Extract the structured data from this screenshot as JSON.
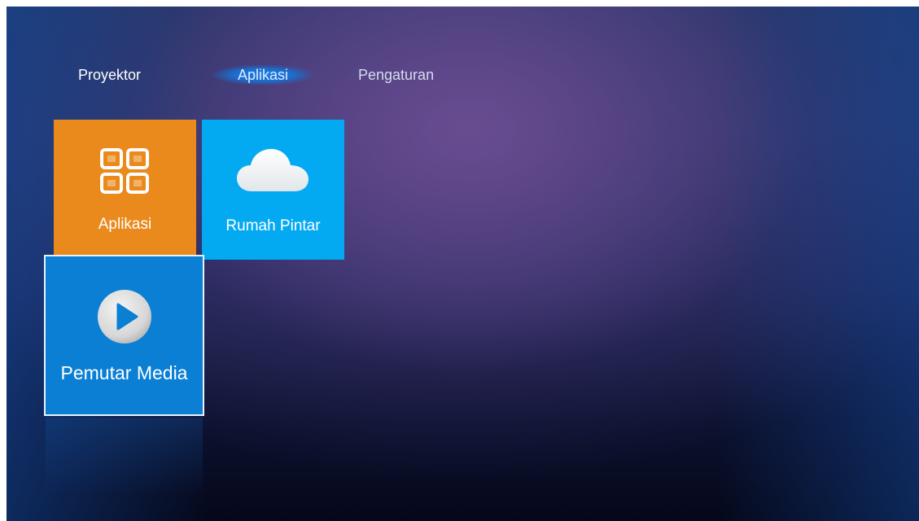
{
  "nav": {
    "tabs": [
      {
        "label": "Proyektor",
        "selected": false
      },
      {
        "label": "Aplikasi",
        "selected": true
      },
      {
        "label": "Pengaturan",
        "selected": false
      }
    ]
  },
  "tiles": [
    {
      "label": "Aplikasi",
      "icon": "apps-grid-icon",
      "color": "#ea8a1c"
    },
    {
      "label": "Rumah Pintar",
      "icon": "cloud-icon",
      "color": "#03aaf2"
    },
    {
      "label": "Pemutar Media",
      "icon": "play-circle-icon",
      "color": "#0b7fd4",
      "focused": true
    }
  ],
  "colors": {
    "accent": "#1a6fd0",
    "focus_border": "#e8f2ff"
  }
}
